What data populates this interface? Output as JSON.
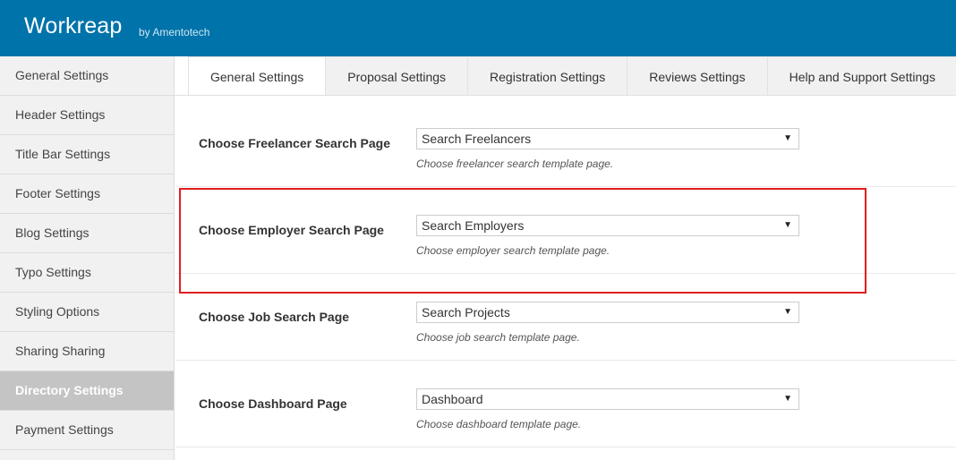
{
  "header": {
    "brand": "Workreap",
    "byline": "by Amentotech"
  },
  "sidebar": {
    "items": [
      {
        "label": "General Settings"
      },
      {
        "label": "Header Settings"
      },
      {
        "label": "Title Bar Settings"
      },
      {
        "label": "Footer Settings"
      },
      {
        "label": "Blog Settings"
      },
      {
        "label": "Typo Settings"
      },
      {
        "label": "Styling Options"
      },
      {
        "label": "Sharing Sharing"
      },
      {
        "label": "Directory Settings"
      },
      {
        "label": "Payment Settings"
      }
    ],
    "active": "Directory Settings"
  },
  "tabs": {
    "items": [
      {
        "label": "General Settings"
      },
      {
        "label": "Proposal Settings"
      },
      {
        "label": "Registration Settings"
      },
      {
        "label": "Reviews Settings"
      },
      {
        "label": "Help and Support Settings"
      }
    ],
    "active": "General Settings"
  },
  "settings": [
    {
      "label": "Choose Freelancer Search Page",
      "value": "Search Freelancers",
      "description": "Choose freelancer search template page."
    },
    {
      "label": "Choose Employer Search Page",
      "value": "Search Employers",
      "description": "Choose employer search template page."
    },
    {
      "label": "Choose Job Search Page",
      "value": "Search Projects",
      "description": "Choose job search template page."
    },
    {
      "label": "Choose Dashboard Page",
      "value": "Dashboard",
      "description": "Choose dashboard template page."
    }
  ],
  "colors": {
    "header": "#0073aa",
    "highlight": "#e01e1e",
    "sidebar_active": "#c4c4c4"
  },
  "icons": {
    "dropdown": "caret-down-icon"
  }
}
